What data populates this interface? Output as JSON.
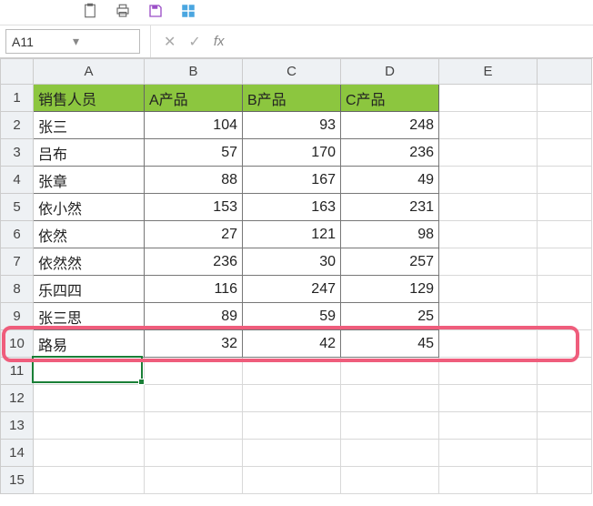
{
  "name_box": "A11",
  "formula_bar": {
    "fx_label": "fx",
    "value": ""
  },
  "columns": [
    "A",
    "B",
    "C",
    "D",
    "E"
  ],
  "row_count": 15,
  "headers": [
    "销售人员",
    "A产品",
    "B产品",
    "C产品"
  ],
  "rows": [
    {
      "name": "张三",
      "a": 104,
      "b": 93,
      "c": 248
    },
    {
      "name": "吕布",
      "a": 57,
      "b": 170,
      "c": 236
    },
    {
      "name": "张章",
      "a": 88,
      "b": 167,
      "c": 49
    },
    {
      "name": "依小然",
      "a": 153,
      "b": 163,
      "c": 231
    },
    {
      "name": "依然",
      "a": 27,
      "b": 121,
      "c": 98
    },
    {
      "name": "依然然",
      "a": 236,
      "b": 30,
      "c": 257
    },
    {
      "name": "乐四四",
      "a": 116,
      "b": 247,
      "c": 129
    },
    {
      "name": "张三思",
      "a": 89,
      "b": 59,
      "c": 25
    },
    {
      "name": "路易",
      "a": 32,
      "b": 42,
      "c": 45
    }
  ],
  "active_cell": "A11",
  "highlight_row": 10
}
